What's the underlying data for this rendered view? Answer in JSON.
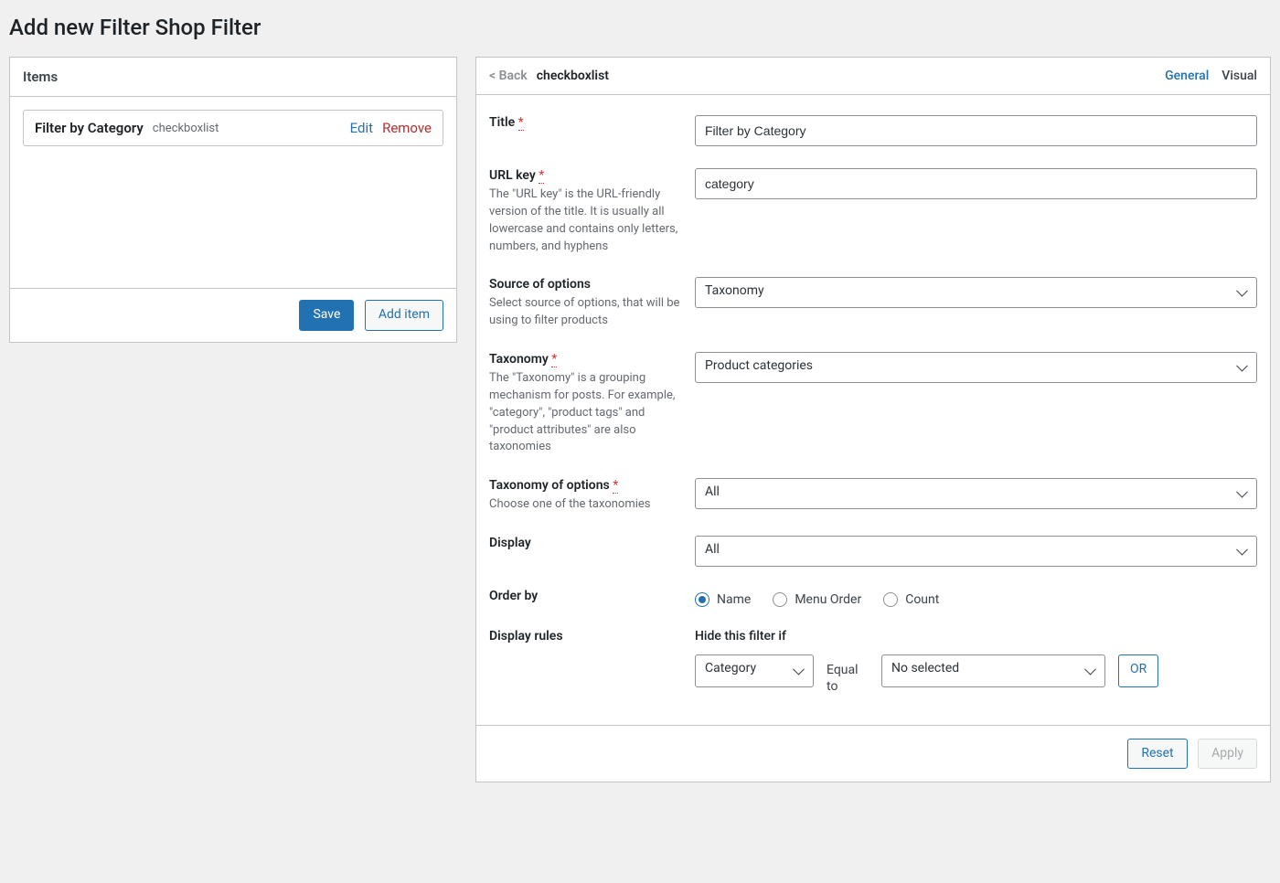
{
  "page": {
    "title": "Add new Filter Shop Filter"
  },
  "left": {
    "header": "Items",
    "item": {
      "title": "Filter by Category",
      "type": "checkboxlist",
      "edit": "Edit",
      "remove": "Remove"
    },
    "save": "Save",
    "add_item": "Add item"
  },
  "right": {
    "back": "< Back",
    "title": "checkboxlist",
    "tabs": {
      "general": "General",
      "visual": "Visual"
    },
    "footer": {
      "reset": "Reset",
      "apply": "Apply"
    }
  },
  "form": {
    "title": {
      "label": "Title",
      "value": "Filter by Category"
    },
    "url_key": {
      "label": "URL key",
      "help": "The \"URL key\" is the URL-friendly version of the title. It is usually all lowercase and contains only letters, numbers, and hyphens",
      "value": "category"
    },
    "source": {
      "label": "Source of options",
      "help": "Select source of options, that will be using to filter products",
      "value": "Taxonomy"
    },
    "taxonomy": {
      "label": "Taxonomy",
      "help": "The \"Taxonomy\" is a grouping mechanism for posts. For example, \"category\", \"product tags\" and \"product attributes\" are also taxonomies",
      "value": "Product categories"
    },
    "tax_options": {
      "label": "Taxonomy of options",
      "help": "Choose one of the taxonomies",
      "value": "All"
    },
    "display": {
      "label": "Display",
      "value": "All"
    },
    "order_by": {
      "label": "Order by",
      "options": {
        "name": "Name",
        "menu": "Menu Order",
        "count": "Count"
      }
    },
    "rules": {
      "label": "Display rules",
      "header": "Hide this filter if",
      "select1": "Category",
      "equal": "Equal to",
      "select2": "No selected",
      "or": "OR"
    }
  }
}
